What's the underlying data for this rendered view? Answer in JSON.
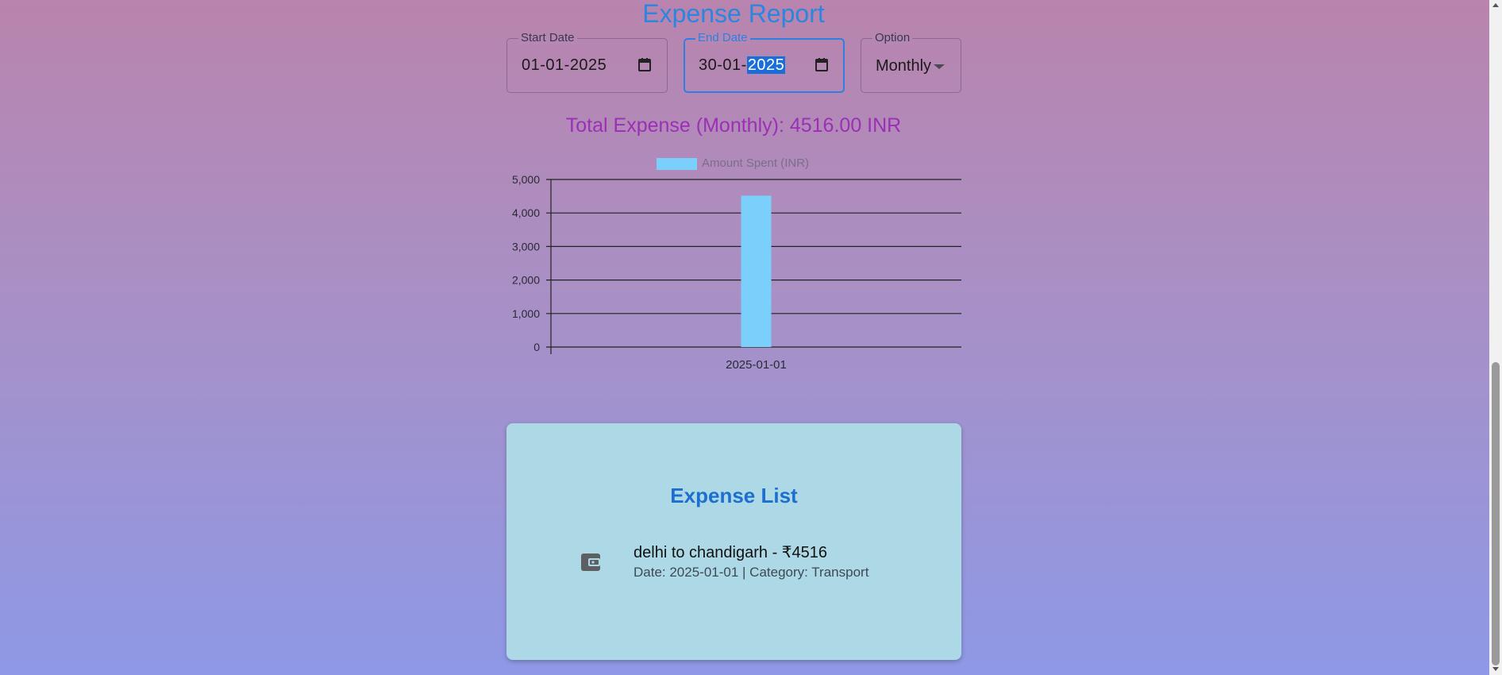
{
  "header": {
    "title": "Expense Report"
  },
  "filters": {
    "start_date": {
      "label": "Start Date",
      "value": "01-01-2025"
    },
    "end_date": {
      "label": "End Date",
      "value_prefix": "30-01-",
      "value_selected": "2025"
    },
    "option": {
      "label": "Option",
      "value": "Monthly"
    }
  },
  "summary": {
    "total_text": "Total Expense (Monthly): 4516.00 INR"
  },
  "chart_data": {
    "type": "bar",
    "categories": [
      "2025-01-01"
    ],
    "series": [
      {
        "name": "Amount Spent (INR)",
        "values": [
          4516
        ]
      }
    ],
    "ylim": [
      0,
      5000
    ],
    "yticks": [
      "0",
      "1,000",
      "2,000",
      "3,000",
      "4,000",
      "5,000"
    ],
    "grid": true,
    "legend_position": "top",
    "bar_color": "#7bd0fb"
  },
  "expense_list": {
    "title": "Expense List",
    "items": [
      {
        "primary": "delhi to chandigarh - ₹4516",
        "secondary": "Date: 2025-01-01 | Category: Transport",
        "icon": "wallet-icon"
      }
    ]
  },
  "colors": {
    "accent": "#2b86e0",
    "total": "#9c2fb6",
    "card_bg": "#add8e6"
  }
}
